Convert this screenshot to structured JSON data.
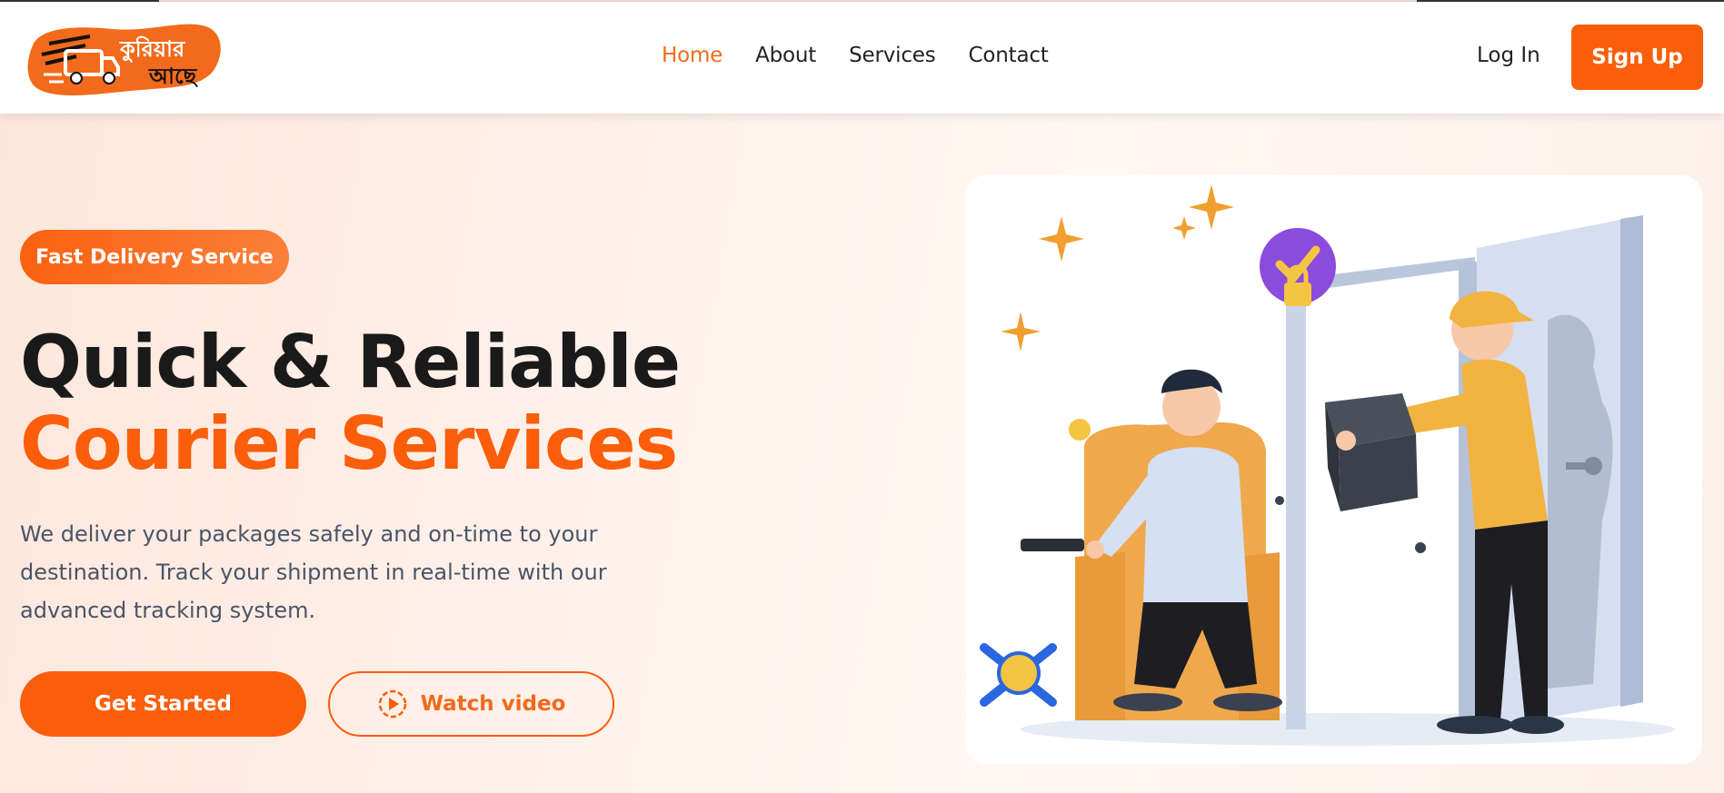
{
  "brand": {
    "logo_text_line1": "কুরিয়ার",
    "logo_text_line2": "আছে",
    "logo_color": "#f26a1b"
  },
  "nav": {
    "items": [
      {
        "label": "Home",
        "active": true
      },
      {
        "label": "About",
        "active": false
      },
      {
        "label": "Services",
        "active": false
      },
      {
        "label": "Contact",
        "active": false
      }
    ]
  },
  "auth": {
    "login_label": "Log In",
    "signup_label": "Sign Up"
  },
  "hero": {
    "badge": "Fast Delivery Service",
    "title_line1": "Quick & Reliable",
    "title_line2": "Courier Services",
    "description": "We deliver your packages safely and on-time to your destination. Track your shipment in real-time with our advanced tracking system.",
    "cta_primary": "Get Started",
    "cta_secondary": "Watch video"
  },
  "colors": {
    "accent": "#fb5e0a",
    "nav_active": "#f26a1b",
    "heading": "#1a1a1a",
    "body_text": "#4a5568"
  },
  "icons": {
    "logo": "delivery-truck-icon",
    "play": "play-circle-icon"
  }
}
